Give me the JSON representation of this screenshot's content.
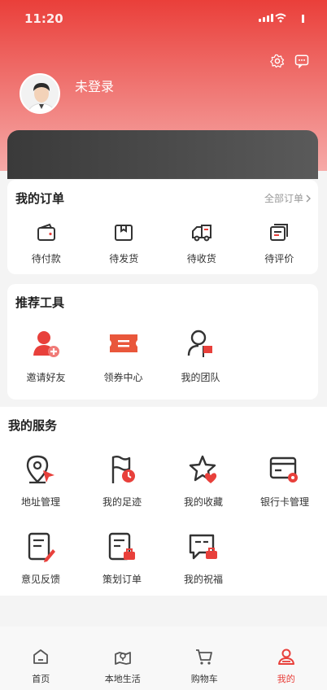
{
  "status": {
    "time": "11:20"
  },
  "header": {
    "login_text": "未登录"
  },
  "orders": {
    "title": "我的订单",
    "all_label": "全部订单",
    "items": [
      {
        "label": "待付款",
        "icon": "wallet-icon"
      },
      {
        "label": "待发货",
        "icon": "box-icon"
      },
      {
        "label": "待收货",
        "icon": "truck-icon"
      },
      {
        "label": "待评价",
        "icon": "review-icon"
      }
    ]
  },
  "tools": {
    "title": "推荐工具",
    "items": [
      {
        "label": "邀请好友",
        "icon": "invite-user-icon"
      },
      {
        "label": "领券中心",
        "icon": "coupon-icon"
      },
      {
        "label": "我的团队",
        "icon": "team-icon"
      }
    ]
  },
  "services": {
    "title": "我的服务",
    "items": [
      {
        "label": "地址管理",
        "icon": "address-icon"
      },
      {
        "label": "我的足迹",
        "icon": "footprint-icon"
      },
      {
        "label": "我的收藏",
        "icon": "favorite-icon"
      },
      {
        "label": "银行卡管理",
        "icon": "bank-card-icon"
      },
      {
        "label": "意见反馈",
        "icon": "feedback-icon"
      },
      {
        "label": "策划订单",
        "icon": "plan-order-icon"
      },
      {
        "label": "我的祝福",
        "icon": "blessing-icon"
      }
    ]
  },
  "tabbar": {
    "items": [
      {
        "label": "首页",
        "icon": "home-icon"
      },
      {
        "label": "本地生活",
        "icon": "local-life-icon"
      },
      {
        "label": "购物车",
        "icon": "cart-icon"
      },
      {
        "label": "我的",
        "icon": "profile-icon"
      }
    ]
  },
  "colors": {
    "accent": "#e8403b",
    "hero_top": "#ea3f3a",
    "hero_bottom": "#f6aaa8"
  }
}
